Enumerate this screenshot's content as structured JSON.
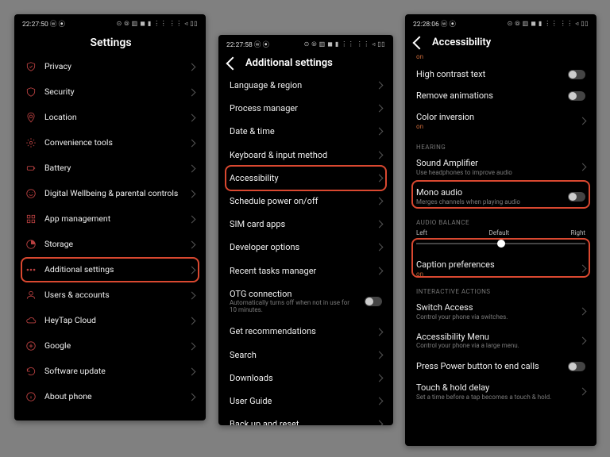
{
  "p1": {
    "time": "22:27:50 ⓦ ⦿",
    "icons": "⊙ ⦾ ▥ ◼ ▮ ⋮⋮ ⋮⋮ ◃ ▯▯",
    "title": "Settings",
    "items": [
      {
        "label": "Privacy",
        "icon": "privacy"
      },
      {
        "label": "Security",
        "icon": "security"
      },
      {
        "label": "Location",
        "icon": "location"
      },
      {
        "label": "Convenience tools",
        "icon": "tools"
      },
      {
        "label": "Battery",
        "icon": "battery"
      },
      {
        "label": "Digital Wellbeing & parental controls",
        "icon": "wellbeing"
      },
      {
        "label": "App management",
        "icon": "apps"
      },
      {
        "label": "Storage",
        "icon": "storage"
      },
      {
        "label": "Additional settings",
        "icon": "additional",
        "highlight": true
      },
      {
        "label": "Users & accounts",
        "icon": "users"
      },
      {
        "label": "HeyTap Cloud",
        "icon": "cloud"
      },
      {
        "label": "Google",
        "icon": "google"
      },
      {
        "label": "Software update",
        "icon": "update"
      },
      {
        "label": "About phone",
        "icon": "about"
      }
    ]
  },
  "p2": {
    "time": "22:27:58 ⓦ ⦿",
    "icons": "⊙ ⦾ ▥ ◼ ▮ ⋮⋮ ⋮⋮ ◃ ▯▯",
    "title": "Additional settings",
    "items": [
      {
        "label": "Language & region"
      },
      {
        "label": "Process manager"
      },
      {
        "label": "Date & time"
      },
      {
        "label": "Keyboard & input method"
      },
      {
        "label": "Accessibility",
        "highlight": true
      },
      {
        "label": "Schedule power on/off"
      },
      {
        "label": "SIM card apps"
      },
      {
        "label": "Developer options"
      },
      {
        "label": "Recent tasks manager"
      },
      {
        "label": "OTG connection",
        "sub": "Automatically turns off when not in use for 10 minutes.",
        "toggle": true
      },
      {
        "label": "Get recommendations"
      },
      {
        "label": "Search"
      },
      {
        "label": "Downloads"
      },
      {
        "label": "User Guide"
      },
      {
        "label": "Back up and reset"
      }
    ]
  },
  "p3": {
    "time": "22:28:06 ⓦ ⦿",
    "icons": "⊙ ⦾ ▥ ◼ ▮ ⋮⋮ ⋮⋮ ◃ ▯▯",
    "title": "Accessibility",
    "topOn": "on",
    "vision": [
      {
        "label": "High contrast text",
        "toggle": true
      },
      {
        "label": "Remove animations",
        "toggle": true
      },
      {
        "label": "Color inversion",
        "on": "on"
      }
    ],
    "hearingTitle": "HEARING",
    "hearing": [
      {
        "label": "Sound Amplifier",
        "sub": "Use headphones to improve audio"
      },
      {
        "label": "Mono audio",
        "sub": "Merges channels when playing audio",
        "toggle": true,
        "highlight": true
      }
    ],
    "balanceTitle": "AUDIO BALANCE",
    "balance": {
      "left": "Left",
      "center": "Default",
      "right": "Right"
    },
    "caption": {
      "label": "Caption preferences",
      "on": "on"
    },
    "interTitle": "INTERACTIVE ACTIONS",
    "inter": [
      {
        "label": "Switch Access",
        "sub": "Control your phone via switches."
      },
      {
        "label": "Accessibility Menu",
        "sub": "Control your phone via a large menu."
      },
      {
        "label": "Press Power button to end calls",
        "toggle": true
      },
      {
        "label": "Touch & hold delay",
        "sub": "Set a time before a tap becomes a touch & hold."
      }
    ]
  }
}
